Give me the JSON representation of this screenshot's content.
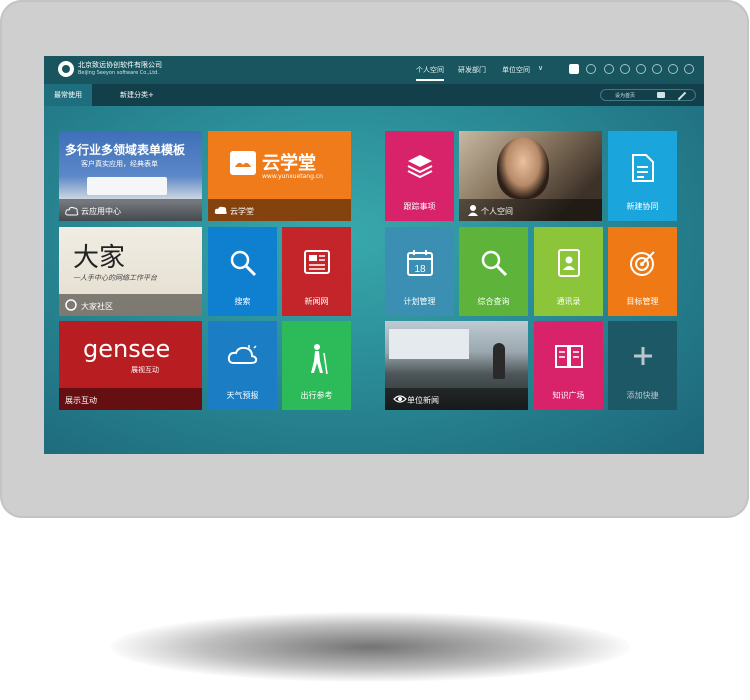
{
  "header": {
    "company_cn": "北京致远协创软件有限公司",
    "company_en": "Beijing Seeyon software Co.,Ltd.",
    "nav": [
      "个人空间",
      "研发部门",
      "单位空间"
    ],
    "nav_more": "∨"
  },
  "toolbar": {
    "tabs": [
      "最常使用",
      "新建分类+"
    ],
    "set_home": "设为首页"
  },
  "tiles": {
    "cloud_app": {
      "banner": "多行业多领域表单模板",
      "sub": "客户真实应用，经典表单",
      "label": "云应用中心"
    },
    "yunxuetang": {
      "title": "云学堂",
      "url": "www.yunxuetang.cn",
      "label": "云学堂"
    },
    "dajia": {
      "title": "大家",
      "sub": "一人手中心的网络工作平台",
      "label": "大家社区"
    },
    "search": {
      "label": "搜索"
    },
    "news_net": {
      "label": "新闻网"
    },
    "gensee": {
      "logo": "gensee",
      "sub": "展视互动",
      "label": "展示互动"
    },
    "weather": {
      "label": "天气预报"
    },
    "travel": {
      "label": "出行参考"
    },
    "tracking": {
      "label": "跟踪事项"
    },
    "personal_space": {
      "label": "个人空间"
    },
    "new_collab": {
      "label": "新建协同"
    },
    "plan": {
      "label": "计划管理",
      "day": "18"
    },
    "query": {
      "label": "综合查询"
    },
    "contacts": {
      "label": "通讯录"
    },
    "goals": {
      "label": "目标管理"
    },
    "unit_news": {
      "label": "单位新闻"
    },
    "knowledge": {
      "label": "知识广场"
    },
    "add_shortcut": {
      "label": "添加快捷"
    }
  },
  "colors": {
    "cloud_app": "#3e6fb8",
    "yunxuetang": "#f07b1a",
    "search": "#0f7fd0",
    "news_net": "#c4252b",
    "gensee": "#b81d22",
    "weather": "#1b7ec4",
    "travel": "#2dbb5a",
    "tracking": "#d8236b",
    "new_collab": "#1aa5dc",
    "plan": "#3b8fb3",
    "query": "#5eb43a",
    "contacts": "#8cc43a",
    "goals": "#ef7a15",
    "knowledge": "#d8236b",
    "add_shortcut": "#1d5867"
  }
}
